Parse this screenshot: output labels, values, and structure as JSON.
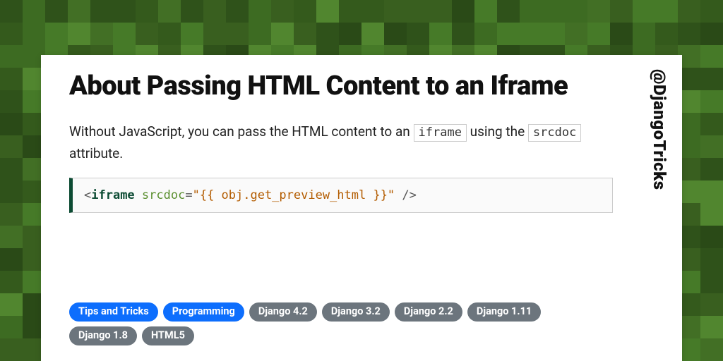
{
  "handle": "@DjangoTricks",
  "title": "About Passing HTML Content to an Iframe",
  "para_pre": "Without JavaScript, you can pass the HTML content to an ",
  "para_code1": "iframe",
  "para_mid": " using the ",
  "para_code2": "srcdoc",
  "para_post": " attribute.",
  "code": {
    "lt": "<",
    "tag": "iframe",
    "sp1": " ",
    "attr": "srcdoc",
    "eq": "=",
    "str": "\"{{ obj.get_preview_html }}\"",
    "close": " />"
  },
  "tags": [
    {
      "label": "Tips and Tricks",
      "style": "blue"
    },
    {
      "label": "Programming",
      "style": "blue"
    },
    {
      "label": "Django 4.2",
      "style": "grey"
    },
    {
      "label": "Django 3.2",
      "style": "grey"
    },
    {
      "label": "Django 2.2",
      "style": "grey"
    },
    {
      "label": "Django 1.11",
      "style": "grey"
    },
    {
      "label": "Django 1.8",
      "style": "grey"
    },
    {
      "label": "HTML5",
      "style": "grey"
    }
  ],
  "bg_palette": [
    "#2a4a17",
    "#345a1c",
    "#3d6b22",
    "#467a28",
    "#51862f",
    "#2f521a",
    "#395f1f",
    "#426f25"
  ]
}
